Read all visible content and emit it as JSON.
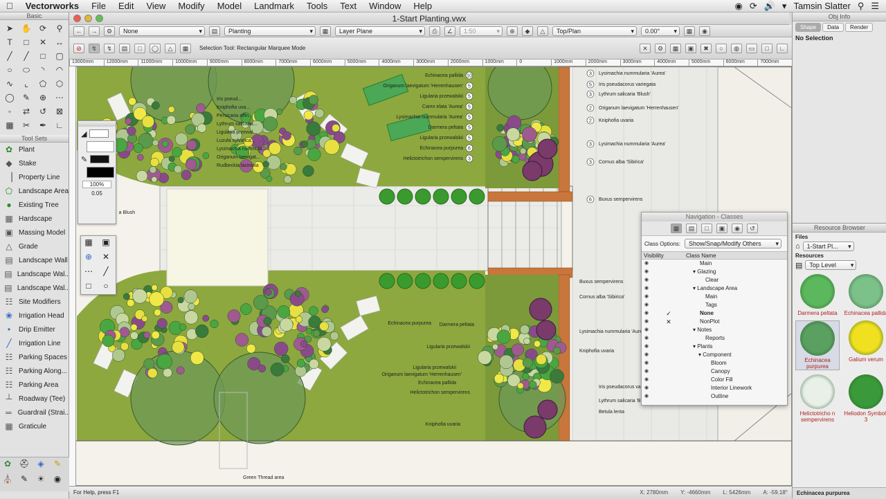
{
  "menubar": {
    "app": "Vectorworks",
    "items": [
      "File",
      "Edit",
      "View",
      "Modify",
      "Model",
      "Landmark",
      "Tools",
      "Text",
      "Window",
      "Help"
    ],
    "user": "Tamsin Slatter"
  },
  "window": {
    "title": "1-Start Planting.vwx"
  },
  "viewbar": {
    "combo_none": "None",
    "combo_class": "Planting",
    "combo_layer": "Layer Plane",
    "scale": "1:50",
    "view": "Top/Plan",
    "angle": "0.00°"
  },
  "modebar": {
    "status": "Selection Tool: Rectangular Marquee Mode"
  },
  "basic": {
    "title": "Basic"
  },
  "toolsets": {
    "title": "Tool Sets",
    "items": [
      "Plant",
      "Stake",
      "Property Line",
      "Landscape Area",
      "Existing Tree",
      "Hardscape",
      "Massing Model",
      "Grade",
      "Landscape Wall",
      "Landscape Wal..",
      "Landscape Wal..",
      "Site Modifiers",
      "Irrigation Head",
      "Drip Emitter",
      "Irrigation Line",
      "Parking Spaces",
      "Parking Along...",
      "Parking Area",
      "Roadway (Tee)",
      "Guardrail (Strai..",
      "Graticule"
    ]
  },
  "attributes": {
    "opacity": "100%",
    "line": "0.05"
  },
  "ruler": {
    "marks": [
      "13000mm",
      "12000mm",
      "11000mm",
      "10000mm",
      "9000mm",
      "8000mm",
      "7000mm",
      "6000mm",
      "5000mm",
      "4000mm",
      "3000mm",
      "2000mm",
      "1000mm",
      "0",
      "1000mm",
      "2000mm",
      "3000mm",
      "4000mm",
      "5000mm",
      "6000mm",
      "7000mm"
    ]
  },
  "statusbar": {
    "help": "For Help, press F1",
    "x": "X: 2780mm",
    "y": "Y: -4660mm",
    "l": "L: 5426mm",
    "a": "A: -59.18°"
  },
  "labels": {
    "tl": [
      "Iris pseud...",
      "Kniphofia uva...",
      "Persicaria affin...",
      "Lythrum salicaria...",
      "Ligularia przewal...",
      "Luzula sylvatica...",
      "Lysimachia nummula...",
      "Origanum laevigat...",
      "Rudbeckia laciniata"
    ],
    "tc": [
      "Echinacea pallida",
      "Origanum laevigatum 'Herrenhausen'",
      "Ligularia przewalskii",
      "Carex elata 'Aurea'",
      "Lysimachia nummularia 'Aurea'",
      "Darmera peltata",
      "Ligularia przewalskii",
      "Echinacea purpurea",
      "Helictotrichon sempervirens"
    ],
    "tcn": [
      "10",
      "5",
      "5",
      "5",
      "5",
      "5",
      "5",
      "6",
      "3"
    ],
    "tr": [
      "Lysimachia nummularia 'Aurea'",
      "Iris pseudacorus variegata",
      "Lythrum salicaria 'Blush'",
      "Origanum laevigatum 'Herrenhausen'",
      "Kniphofia uvaria",
      "Lysimachia nummularia 'Aurea'",
      "Cornus alba 'Sibirica'",
      "Buxus sempervirens"
    ],
    "trn": [
      "3",
      "5",
      "3",
      "2",
      "2",
      "3",
      "3",
      "6"
    ],
    "bc": [
      "Echinacea purpurea",
      "Darmera peltata",
      "Ligularia przewalskii",
      "Ligularia przewalskii",
      "Origanum laevigatum 'Herrenhausen'",
      "Echinacea pallida",
      "Helictotrichon sempervirens",
      "Kniphofia uvaria"
    ],
    "br": [
      "Buxus sempervirens",
      "Cornus alba 'Sibirica'",
      "Lysimachia nummularia 'Aurea'",
      "Kniphofia uvaria",
      "Iris pseudacorus variega...",
      "Lythrum salicaria 'Bl...",
      "Betula lenta"
    ],
    "blush": "a Blush"
  },
  "navpanel": {
    "title": "Navigation - Classes",
    "options_label": "Class Options:",
    "options_value": "Show/Snap/Modify Others",
    "col_visibility": "Visibility",
    "col_name": "Class Name",
    "rows": [
      {
        "name": "Main",
        "indent": 0
      },
      {
        "name": "Glazing",
        "indent": 0,
        "tri": true
      },
      {
        "name": "Clear",
        "indent": 1
      },
      {
        "name": "Landscape Area",
        "indent": 0,
        "tri": true
      },
      {
        "name": "Main",
        "indent": 1
      },
      {
        "name": "Tags",
        "indent": 1
      },
      {
        "name": "None",
        "indent": 0,
        "bold": true,
        "check": true
      },
      {
        "name": "NonPlot",
        "indent": 0,
        "cross": true
      },
      {
        "name": "Notes",
        "indent": 0,
        "tri": true
      },
      {
        "name": "Reports",
        "indent": 1
      },
      {
        "name": "Plants",
        "indent": 0,
        "tri": true
      },
      {
        "name": "Component",
        "indent": 1,
        "tri": true
      },
      {
        "name": "Bloom",
        "indent": 2
      },
      {
        "name": "Canopy",
        "indent": 2
      },
      {
        "name": "Color Fill",
        "indent": 2
      },
      {
        "name": "Interior Linework",
        "indent": 2
      },
      {
        "name": "Outline",
        "indent": 2
      }
    ]
  },
  "objinfo": {
    "title": "Obj Info",
    "tabs": [
      "Shape",
      "Data",
      "Render"
    ],
    "selection": "No Selection"
  },
  "resources": {
    "title": "Resource Browser",
    "files_label": "Files",
    "file": "1-Start Pl...",
    "resources_label": "Resources",
    "level": "Top Level",
    "items": [
      {
        "name": "Darmera peltata",
        "color": "#5cb85c"
      },
      {
        "name": "Echinacea pallida",
        "color": "#7cc08a"
      },
      {
        "name": "Echinacea purpurea",
        "color": "#5aa060"
      },
      {
        "name": "Galium verum",
        "color": "#f0e020"
      },
      {
        "name": "Helictotricho n sempervirens",
        "color": "#e8f0e8"
      },
      {
        "name": "Heliodon Symbol-3",
        "color": "#3a9a3a"
      }
    ],
    "footer": "Echinacea purpurea"
  }
}
